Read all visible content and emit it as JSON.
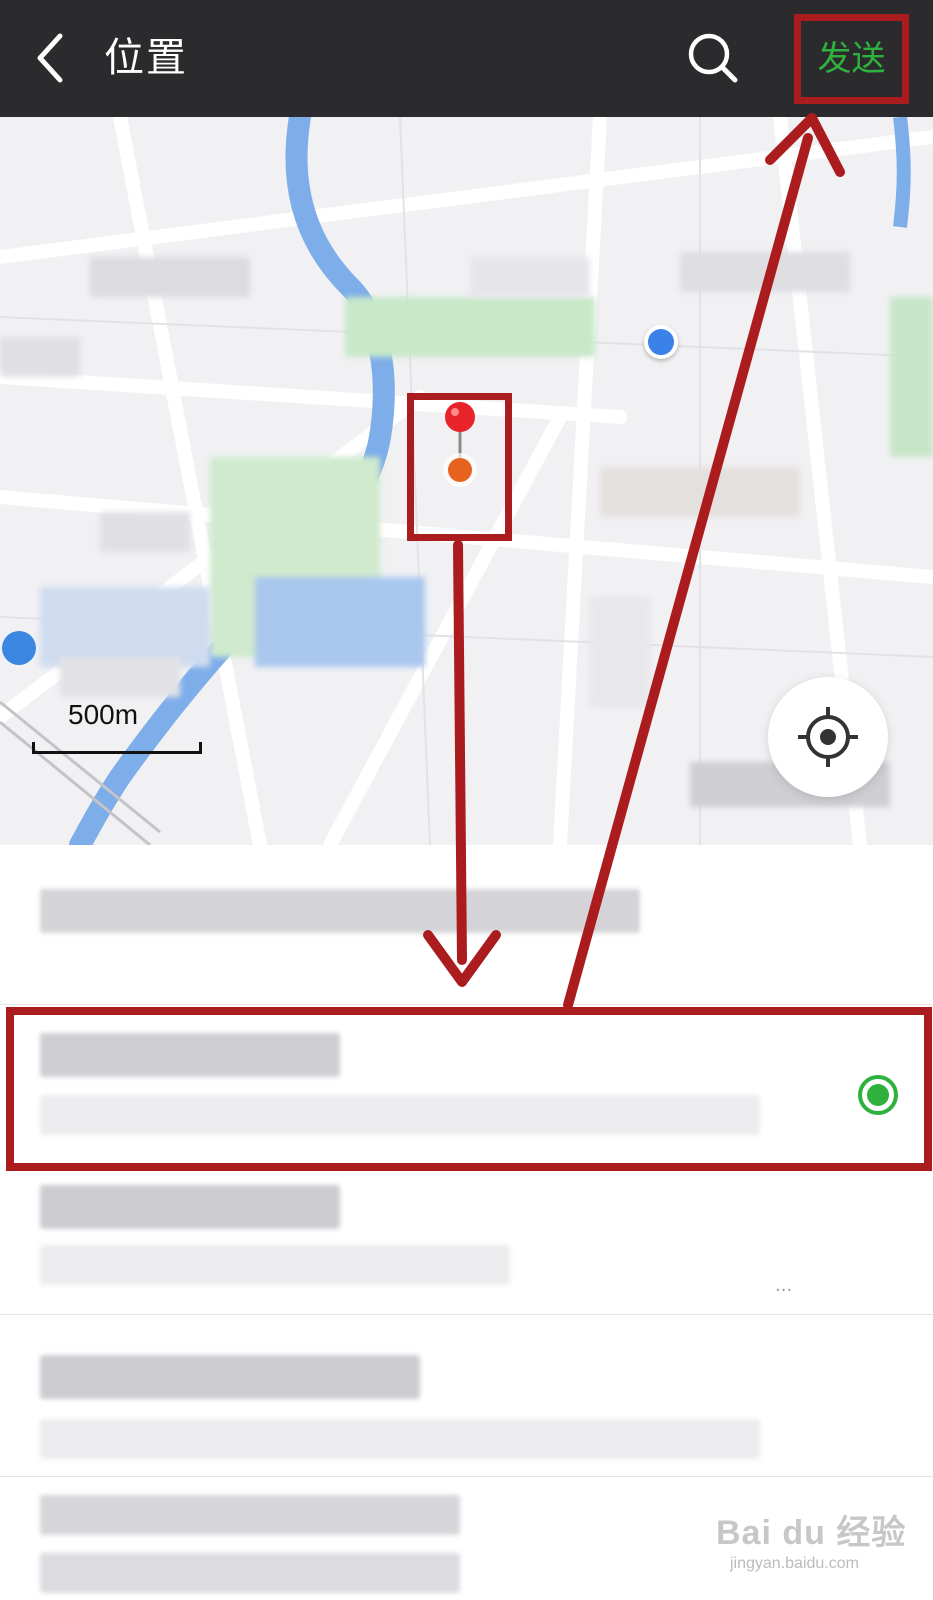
{
  "header": {
    "title": "位置",
    "send_label": "发送",
    "back_icon": "chevron-left-icon",
    "search_icon": "search-icon"
  },
  "map": {
    "scale_label": "500m",
    "locate_icon": "crosshair-icon",
    "pin_icon": "map-pin-icon"
  },
  "list": {
    "selected_index": 1,
    "selected_icon": "radio-checked-icon"
  },
  "watermark": {
    "brand": "Bai du 经验",
    "site": "jingyan.baidu.com"
  },
  "colors": {
    "header_bg": "#2b2b2d",
    "accent_green": "#2fb23d",
    "annotation_red": "#ab1c1f",
    "map_bg": "#f1f1f3",
    "map_water": "#6fa3e8",
    "map_park": "#bfe3c0"
  }
}
